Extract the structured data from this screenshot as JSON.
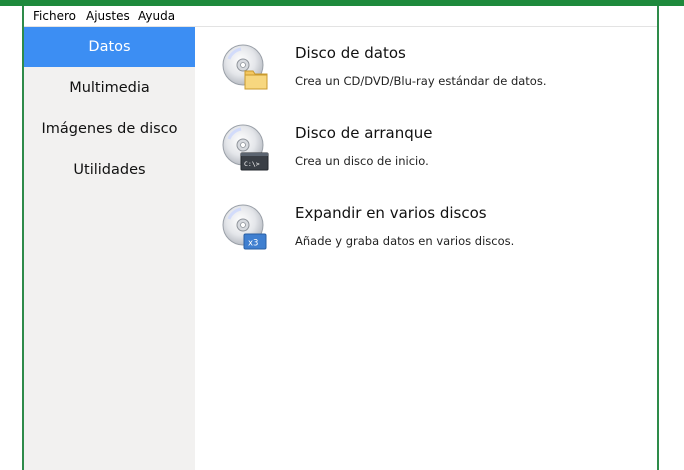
{
  "menu": {
    "items": [
      "Fichero",
      "Ajustes",
      "Ayuda"
    ]
  },
  "sidebar": {
    "items": [
      {
        "label": "Datos",
        "active": true
      },
      {
        "label": "Multimedia",
        "active": false
      },
      {
        "label": "Imágenes de disco",
        "active": false
      },
      {
        "label": "Utilidades",
        "active": false
      }
    ]
  },
  "main": {
    "options": [
      {
        "title": "Disco de datos",
        "description": "Crea un CD/DVD/Blu-ray estándar de datos.",
        "icon": "disc-folder-icon"
      },
      {
        "title": "Disco de arranque",
        "description": "Crea un disco de inicio.",
        "icon": "disc-terminal-icon",
        "badge": "C:\\>"
      },
      {
        "title": "Expandir en varios discos",
        "description": "Añade y graba datos en varios discos.",
        "icon": "disc-multiple-icon",
        "badge": "x3"
      }
    ]
  },
  "colors": {
    "titlebar": "#1e8a3c",
    "sidebar_bg": "#f2f1f0",
    "active_item": "#3c8ef3"
  }
}
